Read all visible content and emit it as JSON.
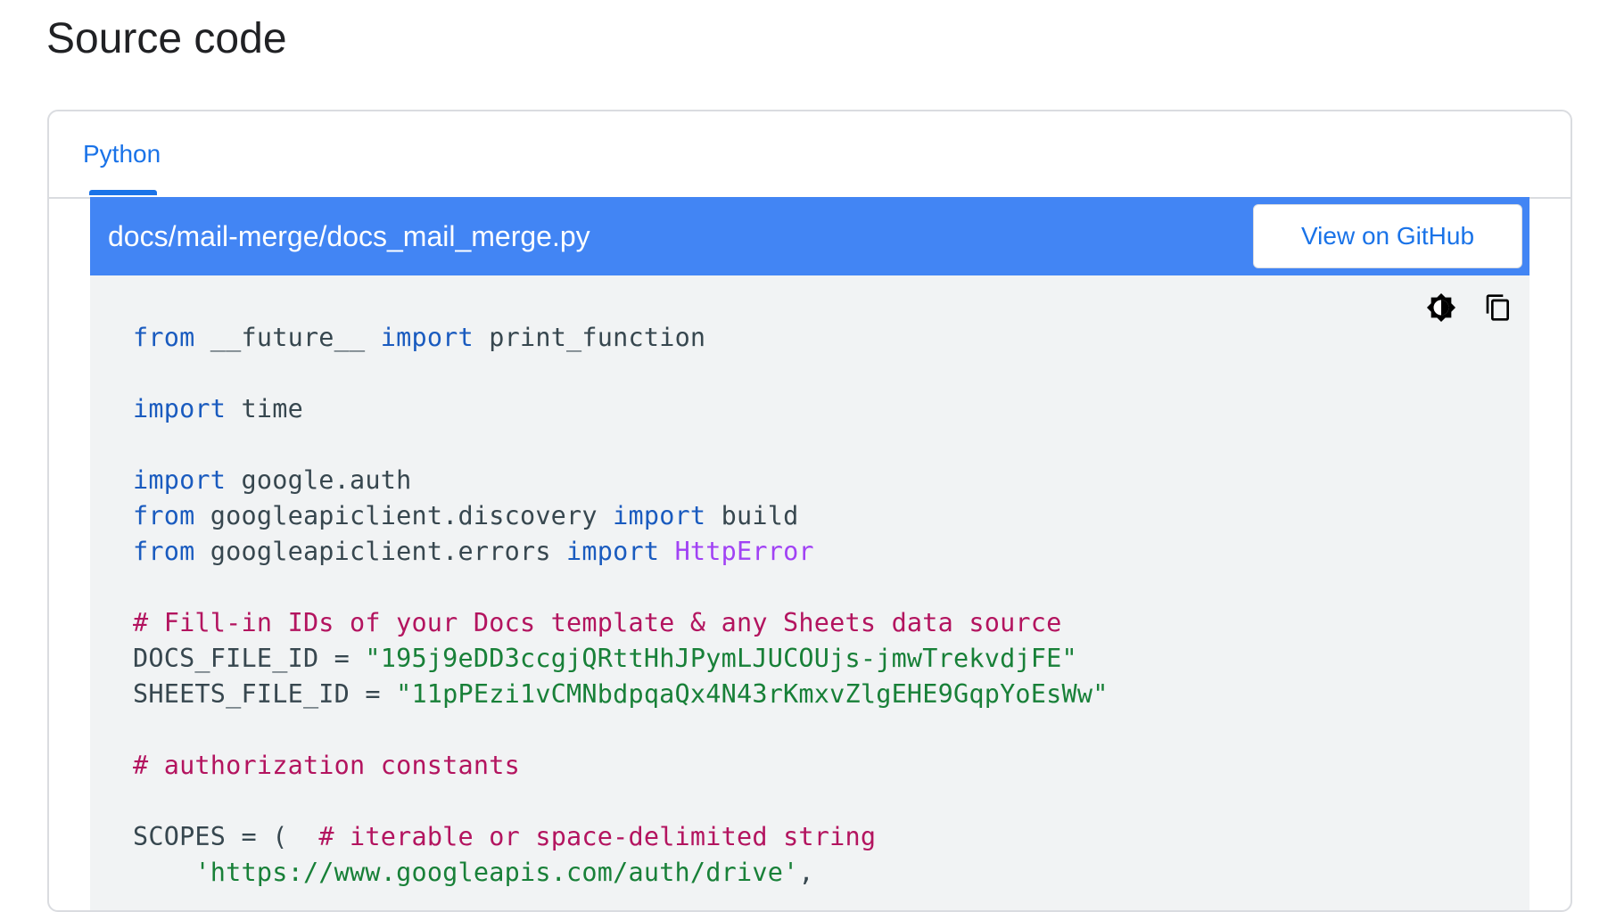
{
  "page": {
    "title": "Source code"
  },
  "tabs": [
    {
      "label": "Python",
      "selected": true
    }
  ],
  "file_header": {
    "path": "docs/mail-merge/docs_mail_merge.py",
    "github_button_label": "View on GitHub",
    "background_color": "#4285f4"
  },
  "toolbar": {
    "theme_toggle_icon": "brightness-contrast-icon",
    "copy_icon": "copy-icon"
  },
  "code": {
    "language": "python",
    "lines": [
      [
        [
          "kw",
          "from"
        ],
        [
          "plain",
          " __future__ "
        ],
        [
          "kw",
          "import"
        ],
        [
          "plain",
          " print_function"
        ]
      ],
      [],
      [
        [
          "kw",
          "import"
        ],
        [
          "plain",
          " time"
        ]
      ],
      [],
      [
        [
          "kw",
          "import"
        ],
        [
          "plain",
          " google.auth"
        ]
      ],
      [
        [
          "kw",
          "from"
        ],
        [
          "plain",
          " googleapiclient.discovery "
        ],
        [
          "kw",
          "import"
        ],
        [
          "plain",
          " build"
        ]
      ],
      [
        [
          "kw",
          "from"
        ],
        [
          "plain",
          " googleapiclient.errors "
        ],
        [
          "kw",
          "import"
        ],
        [
          "plain",
          " "
        ],
        [
          "cls",
          "HttpError"
        ]
      ],
      [],
      [
        [
          "cmt",
          "# Fill-in IDs of your Docs template & any Sheets data source"
        ]
      ],
      [
        [
          "plain",
          "DOCS_FILE_ID = "
        ],
        [
          "str",
          "\"195j9eDD3ccgjQRttHhJPymLJUCOUjs-jmwTrekvdjFE\""
        ]
      ],
      [
        [
          "plain",
          "SHEETS_FILE_ID = "
        ],
        [
          "str",
          "\"11pPEzi1vCMNbdpqaQx4N43rKmxvZlgEHE9GqpYoEsWw\""
        ]
      ],
      [],
      [
        [
          "cmt",
          "# authorization constants"
        ]
      ],
      [],
      [
        [
          "plain",
          "SCOPES = (  "
        ],
        [
          "cmt",
          "# iterable or space-delimited string"
        ]
      ],
      [
        [
          "plain",
          "    "
        ],
        [
          "str",
          "'https://www.googleapis.com/auth/drive'"
        ],
        [
          "plain",
          ","
        ]
      ]
    ]
  },
  "colors": {
    "accent": "#1a73e8",
    "keyword": "#1a5bbf",
    "class_name": "#a142f4",
    "string": "#188038",
    "comment": "#b3145f",
    "code_background": "#f1f3f4"
  }
}
